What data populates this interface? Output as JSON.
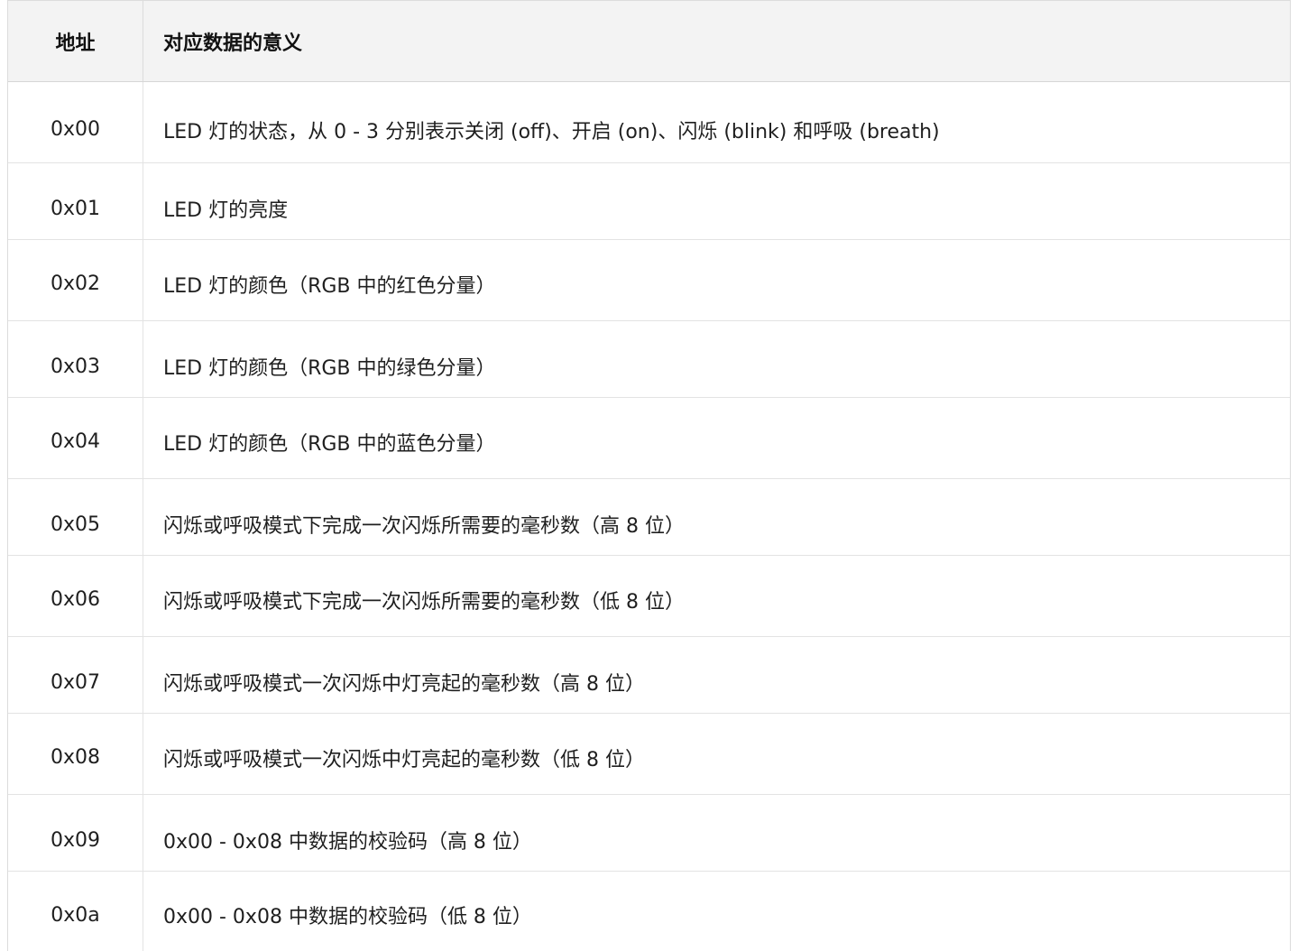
{
  "table": {
    "headers": {
      "address": "地址",
      "meaning": "对应数据的意义"
    },
    "rows": [
      {
        "address": "0x00",
        "meaning": "LED 灯的状态，从 0 - 3 分别表示关闭 (off)、开启 (on)、闪烁 (blink) 和呼吸 (breath)"
      },
      {
        "address": "0x01",
        "meaning": "LED 灯的亮度"
      },
      {
        "address": "0x02",
        "meaning": "LED 灯的颜色（RGB 中的红色分量）"
      },
      {
        "address": "0x03",
        "meaning": "LED 灯的颜色（RGB 中的绿色分量）"
      },
      {
        "address": "0x04",
        "meaning": "LED 灯的颜色（RGB 中的蓝色分量）"
      },
      {
        "address": "0x05",
        "meaning": "闪烁或呼吸模式下完成一次闪烁所需要的毫秒数（高 8 位）"
      },
      {
        "address": "0x06",
        "meaning": "闪烁或呼吸模式下完成一次闪烁所需要的毫秒数（低 8 位）"
      },
      {
        "address": "0x07",
        "meaning": "闪烁或呼吸模式一次闪烁中灯亮起的毫秒数（高 8 位）"
      },
      {
        "address": "0x08",
        "meaning": "闪烁或呼吸模式一次闪烁中灯亮起的毫秒数（低 8 位）"
      },
      {
        "address": "0x09",
        "meaning": "0x00 - 0x08 中数据的校验码（高 8 位）"
      },
      {
        "address": "0x0a",
        "meaning": "0x00 - 0x08 中数据的校验码（低 8 位）"
      }
    ]
  },
  "colors": {
    "header_background": "#f3f3f3",
    "border": "#e3e3e3",
    "text": "#1f1f1f"
  }
}
